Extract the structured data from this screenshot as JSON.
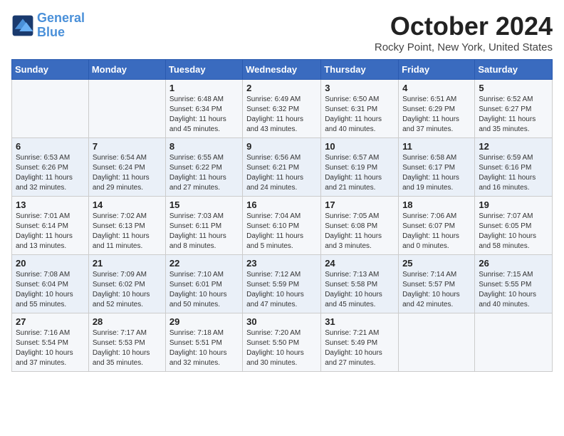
{
  "logo": {
    "line1": "General",
    "line2": "Blue"
  },
  "title": "October 2024",
  "subtitle": "Rocky Point, New York, United States",
  "weekdays": [
    "Sunday",
    "Monday",
    "Tuesday",
    "Wednesday",
    "Thursday",
    "Friday",
    "Saturday"
  ],
  "weeks": [
    [
      {
        "day": "",
        "sunrise": "",
        "sunset": "",
        "daylight": ""
      },
      {
        "day": "",
        "sunrise": "",
        "sunset": "",
        "daylight": ""
      },
      {
        "day": "1",
        "sunrise": "Sunrise: 6:48 AM",
        "sunset": "Sunset: 6:34 PM",
        "daylight": "Daylight: 11 hours and 45 minutes."
      },
      {
        "day": "2",
        "sunrise": "Sunrise: 6:49 AM",
        "sunset": "Sunset: 6:32 PM",
        "daylight": "Daylight: 11 hours and 43 minutes."
      },
      {
        "day": "3",
        "sunrise": "Sunrise: 6:50 AM",
        "sunset": "Sunset: 6:31 PM",
        "daylight": "Daylight: 11 hours and 40 minutes."
      },
      {
        "day": "4",
        "sunrise": "Sunrise: 6:51 AM",
        "sunset": "Sunset: 6:29 PM",
        "daylight": "Daylight: 11 hours and 37 minutes."
      },
      {
        "day": "5",
        "sunrise": "Sunrise: 6:52 AM",
        "sunset": "Sunset: 6:27 PM",
        "daylight": "Daylight: 11 hours and 35 minutes."
      }
    ],
    [
      {
        "day": "6",
        "sunrise": "Sunrise: 6:53 AM",
        "sunset": "Sunset: 6:26 PM",
        "daylight": "Daylight: 11 hours and 32 minutes."
      },
      {
        "day": "7",
        "sunrise": "Sunrise: 6:54 AM",
        "sunset": "Sunset: 6:24 PM",
        "daylight": "Daylight: 11 hours and 29 minutes."
      },
      {
        "day": "8",
        "sunrise": "Sunrise: 6:55 AM",
        "sunset": "Sunset: 6:22 PM",
        "daylight": "Daylight: 11 hours and 27 minutes."
      },
      {
        "day": "9",
        "sunrise": "Sunrise: 6:56 AM",
        "sunset": "Sunset: 6:21 PM",
        "daylight": "Daylight: 11 hours and 24 minutes."
      },
      {
        "day": "10",
        "sunrise": "Sunrise: 6:57 AM",
        "sunset": "Sunset: 6:19 PM",
        "daylight": "Daylight: 11 hours and 21 minutes."
      },
      {
        "day": "11",
        "sunrise": "Sunrise: 6:58 AM",
        "sunset": "Sunset: 6:17 PM",
        "daylight": "Daylight: 11 hours and 19 minutes."
      },
      {
        "day": "12",
        "sunrise": "Sunrise: 6:59 AM",
        "sunset": "Sunset: 6:16 PM",
        "daylight": "Daylight: 11 hours and 16 minutes."
      }
    ],
    [
      {
        "day": "13",
        "sunrise": "Sunrise: 7:01 AM",
        "sunset": "Sunset: 6:14 PM",
        "daylight": "Daylight: 11 hours and 13 minutes."
      },
      {
        "day": "14",
        "sunrise": "Sunrise: 7:02 AM",
        "sunset": "Sunset: 6:13 PM",
        "daylight": "Daylight: 11 hours and 11 minutes."
      },
      {
        "day": "15",
        "sunrise": "Sunrise: 7:03 AM",
        "sunset": "Sunset: 6:11 PM",
        "daylight": "Daylight: 11 hours and 8 minutes."
      },
      {
        "day": "16",
        "sunrise": "Sunrise: 7:04 AM",
        "sunset": "Sunset: 6:10 PM",
        "daylight": "Daylight: 11 hours and 5 minutes."
      },
      {
        "day": "17",
        "sunrise": "Sunrise: 7:05 AM",
        "sunset": "Sunset: 6:08 PM",
        "daylight": "Daylight: 11 hours and 3 minutes."
      },
      {
        "day": "18",
        "sunrise": "Sunrise: 7:06 AM",
        "sunset": "Sunset: 6:07 PM",
        "daylight": "Daylight: 11 hours and 0 minutes."
      },
      {
        "day": "19",
        "sunrise": "Sunrise: 7:07 AM",
        "sunset": "Sunset: 6:05 PM",
        "daylight": "Daylight: 10 hours and 58 minutes."
      }
    ],
    [
      {
        "day": "20",
        "sunrise": "Sunrise: 7:08 AM",
        "sunset": "Sunset: 6:04 PM",
        "daylight": "Daylight: 10 hours and 55 minutes."
      },
      {
        "day": "21",
        "sunrise": "Sunrise: 7:09 AM",
        "sunset": "Sunset: 6:02 PM",
        "daylight": "Daylight: 10 hours and 52 minutes."
      },
      {
        "day": "22",
        "sunrise": "Sunrise: 7:10 AM",
        "sunset": "Sunset: 6:01 PM",
        "daylight": "Daylight: 10 hours and 50 minutes."
      },
      {
        "day": "23",
        "sunrise": "Sunrise: 7:12 AM",
        "sunset": "Sunset: 5:59 PM",
        "daylight": "Daylight: 10 hours and 47 minutes."
      },
      {
        "day": "24",
        "sunrise": "Sunrise: 7:13 AM",
        "sunset": "Sunset: 5:58 PM",
        "daylight": "Daylight: 10 hours and 45 minutes."
      },
      {
        "day": "25",
        "sunrise": "Sunrise: 7:14 AM",
        "sunset": "Sunset: 5:57 PM",
        "daylight": "Daylight: 10 hours and 42 minutes."
      },
      {
        "day": "26",
        "sunrise": "Sunrise: 7:15 AM",
        "sunset": "Sunset: 5:55 PM",
        "daylight": "Daylight: 10 hours and 40 minutes."
      }
    ],
    [
      {
        "day": "27",
        "sunrise": "Sunrise: 7:16 AM",
        "sunset": "Sunset: 5:54 PM",
        "daylight": "Daylight: 10 hours and 37 minutes."
      },
      {
        "day": "28",
        "sunrise": "Sunrise: 7:17 AM",
        "sunset": "Sunset: 5:53 PM",
        "daylight": "Daylight: 10 hours and 35 minutes."
      },
      {
        "day": "29",
        "sunrise": "Sunrise: 7:18 AM",
        "sunset": "Sunset: 5:51 PM",
        "daylight": "Daylight: 10 hours and 32 minutes."
      },
      {
        "day": "30",
        "sunrise": "Sunrise: 7:20 AM",
        "sunset": "Sunset: 5:50 PM",
        "daylight": "Daylight: 10 hours and 30 minutes."
      },
      {
        "day": "31",
        "sunrise": "Sunrise: 7:21 AM",
        "sunset": "Sunset: 5:49 PM",
        "daylight": "Daylight: 10 hours and 27 minutes."
      },
      {
        "day": "",
        "sunrise": "",
        "sunset": "",
        "daylight": ""
      },
      {
        "day": "",
        "sunrise": "",
        "sunset": "",
        "daylight": ""
      }
    ]
  ]
}
